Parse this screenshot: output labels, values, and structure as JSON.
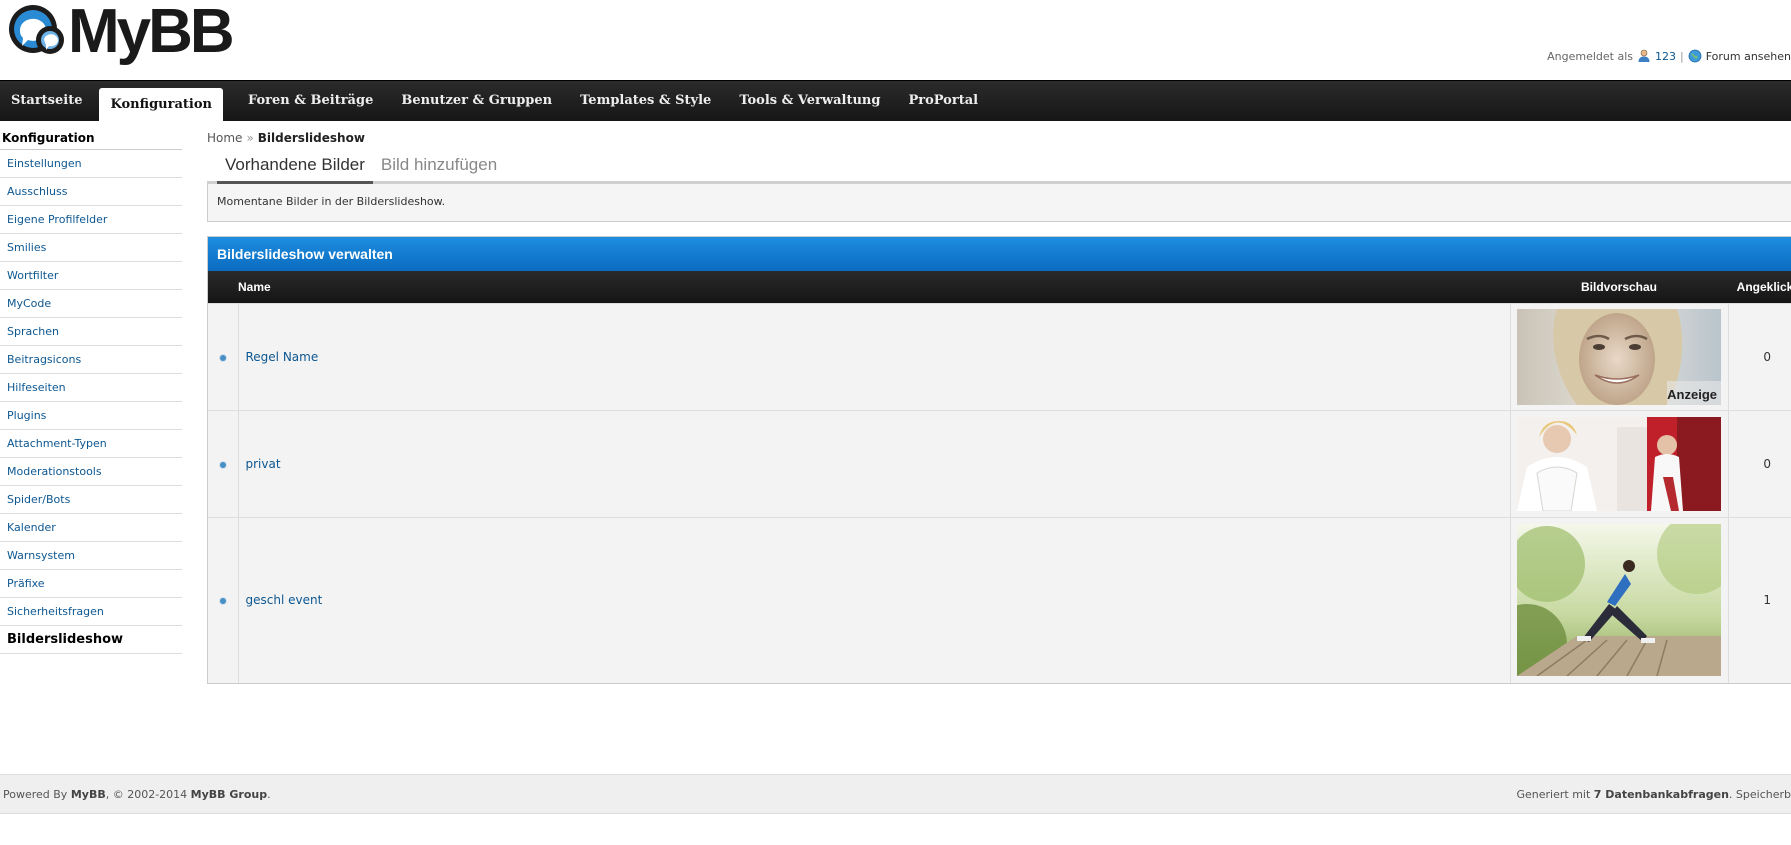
{
  "header": {
    "logo_text": "MyBB",
    "welcome_prefix": "Angemeldet als",
    "username": "123",
    "separator": "|",
    "view_forum": "Forum ansehen"
  },
  "menu": {
    "items": [
      {
        "label": "Startseite"
      },
      {
        "label": "Konfiguration",
        "active": true
      },
      {
        "label": "Foren & Beiträge"
      },
      {
        "label": "Benutzer & Gruppen"
      },
      {
        "label": "Templates & Style"
      },
      {
        "label": "Tools & Verwaltung"
      },
      {
        "label": "ProPortal"
      }
    ]
  },
  "sidebar": {
    "title": "Konfiguration",
    "items": [
      {
        "label": "Einstellungen"
      },
      {
        "label": "Ausschluss"
      },
      {
        "label": "Eigene Profilfelder"
      },
      {
        "label": "Smilies"
      },
      {
        "label": "Wortfilter"
      },
      {
        "label": "MyCode"
      },
      {
        "label": "Sprachen"
      },
      {
        "label": "Beitragsicons"
      },
      {
        "label": "Hilfeseiten"
      },
      {
        "label": "Plugins"
      },
      {
        "label": "Attachment-Typen"
      },
      {
        "label": "Moderationstools"
      },
      {
        "label": "Spider/Bots"
      },
      {
        "label": "Kalender"
      },
      {
        "label": "Warnsystem"
      },
      {
        "label": "Präfixe"
      },
      {
        "label": "Sicherheitsfragen"
      },
      {
        "label": "Bilderslideshow",
        "current": true
      }
    ]
  },
  "breadcrumb": {
    "home": "Home",
    "sep": "»",
    "current": "Bilderslideshow"
  },
  "tabs": [
    {
      "label": "Vorhandene Bilder",
      "active": true
    },
    {
      "label": "Bild hinzufügen"
    }
  ],
  "description": "Momentane Bilder in der Bilderslideshow.",
  "panel": {
    "title": "Bilderslideshow verwalten",
    "columns": {
      "name": "Name",
      "preview": "Bildvorschau",
      "clicked": "Angeklickt"
    },
    "rows": [
      {
        "name": "Regel Name",
        "clicked": "0",
        "preview_label": "Anzeige"
      },
      {
        "name": "privat",
        "clicked": "0",
        "preview_label": ""
      },
      {
        "name": "geschl event",
        "clicked": "1",
        "preview_label": ""
      }
    ]
  },
  "footer": {
    "powered_prefix": "Powered By",
    "mybb": "MyBB",
    "copyright": ", © 2002-2014",
    "group": "MyBB Group",
    "period": ".",
    "generated_prefix": "Generiert mit",
    "queries": "7 Datenbankabfragen",
    "memory_prefix": ". Speicherb"
  },
  "colors": {
    "menu_bg": "#1d1d1d",
    "panel_header": "#0f78cc",
    "link": "#0d5791",
    "row_bg": "#f3f3f3"
  }
}
